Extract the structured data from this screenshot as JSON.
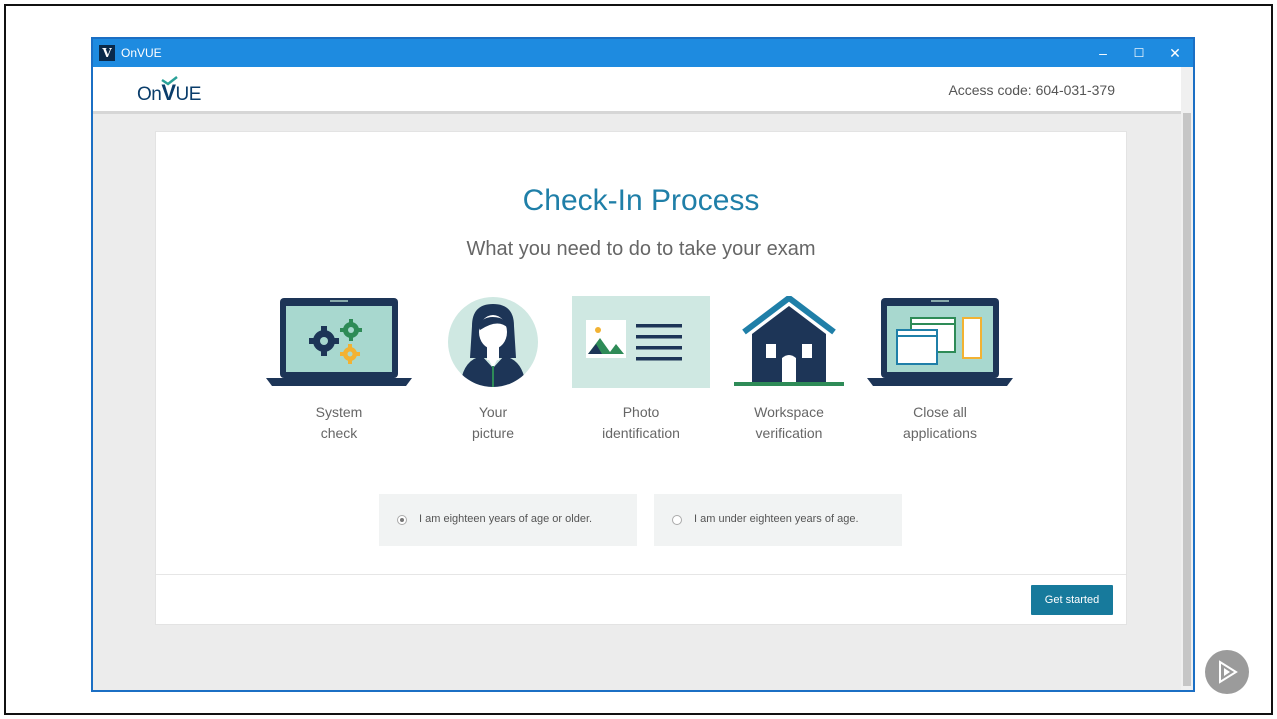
{
  "window": {
    "title": "OnVUE",
    "app_icon_letter": "V",
    "controls": {
      "minimize": "–",
      "maximize": "☐",
      "close": "✕"
    }
  },
  "header": {
    "logo_prefix": "On",
    "logo_v": "V",
    "logo_suffix": "UE",
    "access_code": "Access code: 604-031-379"
  },
  "checkin": {
    "title": "Check-In Process",
    "subtitle": "What you need to do to take your exam",
    "steps": [
      {
        "icon": "system-check-icon",
        "line1": "System",
        "line2": "check"
      },
      {
        "icon": "your-picture-icon",
        "line1": "Your",
        "line2": "picture"
      },
      {
        "icon": "photo-id-icon",
        "line1": "Photo",
        "line2": "identification"
      },
      {
        "icon": "workspace-icon",
        "line1": "Workspace",
        "line2": "verification"
      },
      {
        "icon": "close-apps-icon",
        "line1": "Close all",
        "line2": "applications"
      }
    ],
    "age_options": [
      {
        "label": "I am eighteen years of age or older.",
        "selected": true
      },
      {
        "label": "I am under eighteen years of age.",
        "selected": false
      }
    ],
    "primary_button": "Get started"
  },
  "colors": {
    "titlebar": "#1e8be0",
    "accent": "#1f7fa8",
    "button": "#177a9c",
    "illustration_navy": "#1d3557",
    "illustration_green": "#2e8b57"
  }
}
